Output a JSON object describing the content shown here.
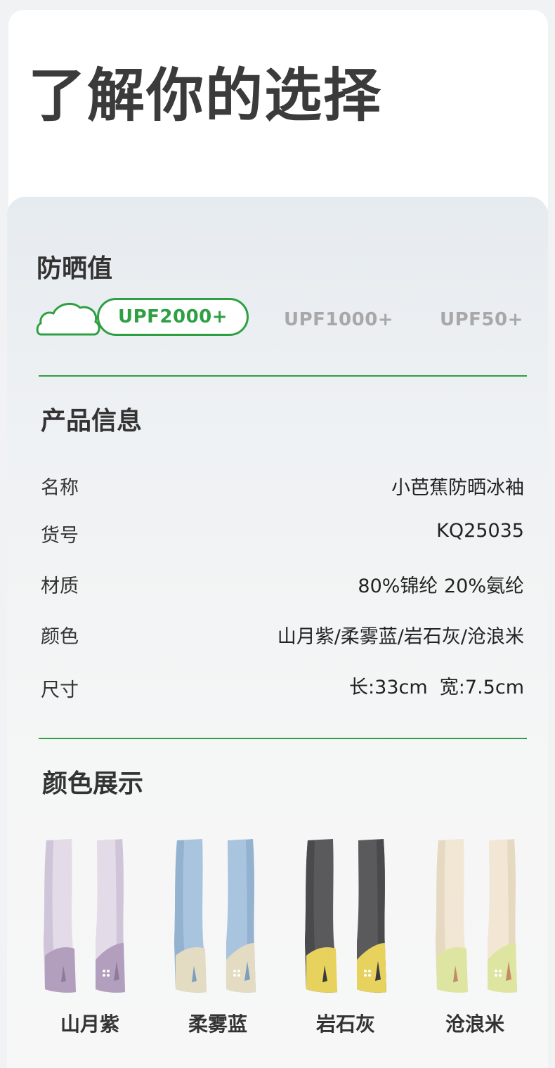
{
  "header": {
    "title": "了解你的选择"
  },
  "uv": {
    "label": "防晒值",
    "options": [
      {
        "label": "UPF2000+",
        "selected": true
      },
      {
        "label": "UPF1000+",
        "selected": false
      },
      {
        "label": "UPF50+",
        "selected": false
      }
    ],
    "accent": "#2ea043"
  },
  "product": {
    "label": "产品信息",
    "rows": [
      {
        "key": "名称",
        "value": "小芭蕉防晒冰袖"
      },
      {
        "key": "货号",
        "value": "KQ25035"
      },
      {
        "key": "材质",
        "value": "80%锦纶 20%氨纶"
      },
      {
        "key": "颜色",
        "value": "山月紫/柔雾蓝/岩石灰/沧浪米"
      },
      {
        "key": "尺寸",
        "value": "长:33cm  宽:7.5cm"
      }
    ]
  },
  "colors": {
    "label": "颜色展示",
    "items": [
      {
        "name": "山月紫",
        "body": "#e3dbe8",
        "shade": "#cfc4d8",
        "cuff": "#b29fbe",
        "accent": "#8e7a9a"
      },
      {
        "name": "柔雾蓝",
        "body": "#a9c4de",
        "shade": "#93b2d0",
        "cuff": "#e3dcc2",
        "accent": "#7d9ec1"
      },
      {
        "name": "岩石灰",
        "body": "#5a5a5c",
        "shade": "#4a4a4c",
        "cuff": "#e6d25c",
        "accent": "#3a3a3c"
      },
      {
        "name": "沧浪米",
        "body": "#f1e7d4",
        "shade": "#e6d9c1",
        "cuff": "#dde5a0",
        "accent": "#c58a68"
      }
    ]
  }
}
